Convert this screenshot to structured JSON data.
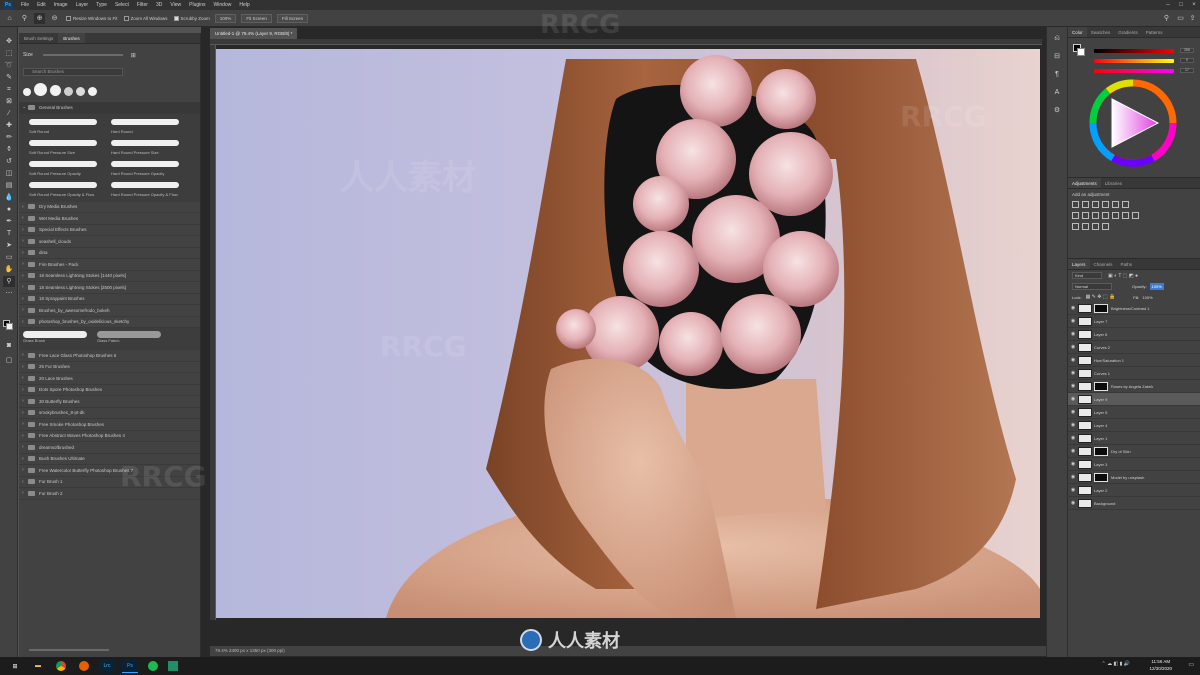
{
  "menubar": {
    "logo": "Ps",
    "items": [
      "File",
      "Edit",
      "Image",
      "Layer",
      "Type",
      "Select",
      "Filter",
      "3D",
      "View",
      "Plugins",
      "Window",
      "Help"
    ]
  },
  "optionsbar": {
    "resize_windows": "Resize Windows to Fit",
    "zoom_all_windows": "Zoom All Windows",
    "scrubby_zoom": "Scrubby Zoom",
    "zoom_level": "100%",
    "fit_screen": "Fit Screen",
    "fill_screen": "Fill Screen"
  },
  "brushes_panel": {
    "tabs": [
      "Brush Settings",
      "Brushes"
    ],
    "search_placeholder": "Search Brushes",
    "size_label": "Size",
    "general_group": "General Brushes",
    "general_brushes": [
      "Soft Round",
      "Hard Round",
      "Soft Round Pressure Size",
      "Hard Round Pressure Size",
      "Soft Round Pressure Opacity",
      "Hard Round Pressure Opacity",
      "Soft Round Pressure Opacity & Flow",
      "Hard Round Pressure Opacity & Flow"
    ],
    "folders_a": [
      "Dry Media Brushes",
      "Wet Media Brushes",
      "Special Effects Brushes",
      "seashell_clouds",
      "dina",
      "Fire Brushes - Pack",
      "18 Seamless Lightning Stokes [1440 pixels]",
      "18 Seamless Lightning Stokes [2500 pixels]",
      "18 Spraypaint Brushes",
      "Brushes_by_awesomefrodo_bokeh",
      "photoshop_brushes_by_oxidelicious_sketchy"
    ],
    "loose_brushes": [
      "Grass Brush",
      "Glass Fabric"
    ],
    "folders_b": [
      "Free Lace Glass Photoshop Brushes 6",
      "25 Fur Brushes",
      "20 Lace Brushes",
      "Dots Spore Photoshop Brushes",
      "30 Butterfly Brushes",
      "smokybrushes_8-pt-dk",
      "Free Smoke Photoshop Brushes",
      "Free Abstract Waves Photoshop Brushes 4",
      "dreamsofbrushed",
      "Bush Brushes Ultimate",
      "Free Watercolor Butterfly Photoshop Brushes 7",
      "Fur Brush 1",
      "Fur Brush 2"
    ]
  },
  "document": {
    "tab_title": "Untitled-1 @ 79.4% (Layer 9, RGB/8) *",
    "status": "79.4%   2400 px x 1350 px (300 ppi)"
  },
  "color_panel": {
    "tabs": [
      "Color",
      "Swatches",
      "Gradients",
      "Patterns"
    ],
    "values": [
      "255",
      "0",
      "17"
    ]
  },
  "adjustments_panel": {
    "tabs": [
      "Adjustments",
      "Libraries"
    ],
    "subtitle": "Add an adjustment"
  },
  "layers_panel": {
    "tabs": [
      "Layers",
      "Channels",
      "Paths"
    ],
    "kind_label": "Kind",
    "blend_mode": "Normal",
    "opacity_label": "Opacity:",
    "opacity_value": "100%",
    "lock_label": "Lock:",
    "fill_label": "Fill:",
    "fill_value": "100%",
    "layers": [
      {
        "name": "Brightness/Contrast 1",
        "mask": true
      },
      {
        "name": "Layer 7",
        "mask": false
      },
      {
        "name": "Layer 6",
        "mask": false
      },
      {
        "name": "Curves 2",
        "mask": false
      },
      {
        "name": "Hue/Saturation 1",
        "mask": false
      },
      {
        "name": "Curves 1",
        "mask": false
      },
      {
        "name": "Roses by Angela Zabrik",
        "mask": true
      },
      {
        "name": "Layer 9",
        "mask": false
      },
      {
        "name": "Layer 5",
        "mask": false
      },
      {
        "name": "Layer 4",
        "mask": false
      },
      {
        "name": "Layer 1",
        "mask": false
      },
      {
        "name": "Dry of Skin",
        "mask": true
      },
      {
        "name": "Layer 3",
        "mask": false
      },
      {
        "name": "Model by unsplash",
        "mask": true
      },
      {
        "name": "Layer 2",
        "mask": false
      },
      {
        "name": "Background",
        "mask": false
      }
    ]
  },
  "taskbar": {
    "time": "11:56 AM",
    "date": "12/30/2020"
  },
  "watermark": {
    "text_latin": "RRCG",
    "text_cjk": "人人素材"
  }
}
